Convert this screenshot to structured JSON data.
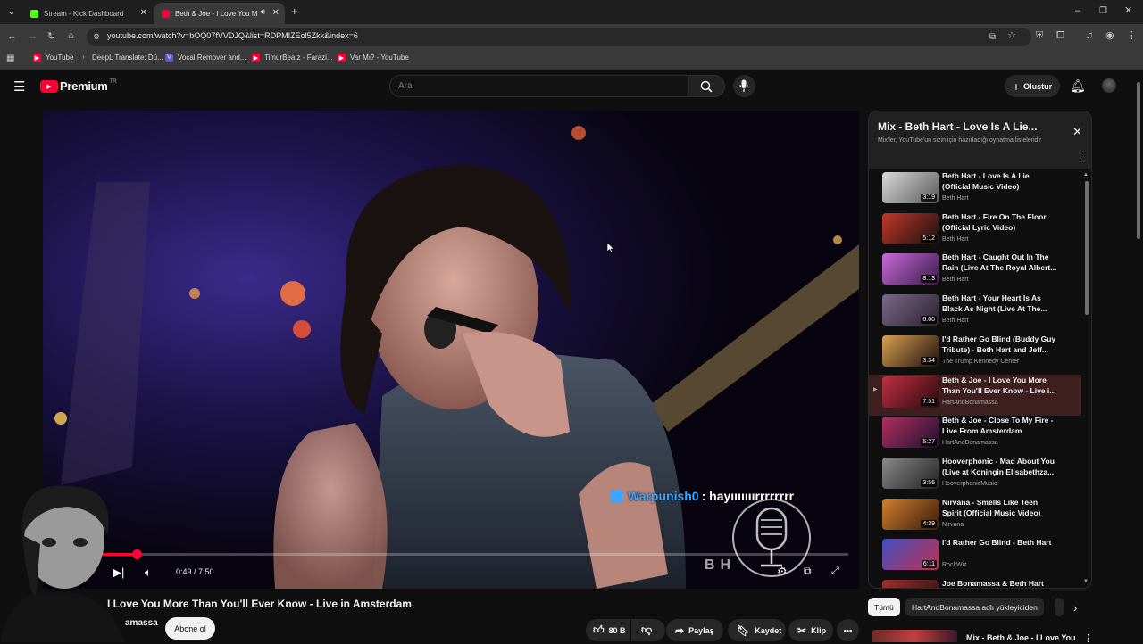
{
  "browser": {
    "tabs": [
      {
        "title": "Stream - Kick Dashboard",
        "active": false,
        "color": "#53fc18"
      },
      {
        "title": "Beth & Joe - I Love You Mo",
        "active": true,
        "color": "#ff0033"
      }
    ],
    "url": "youtube.com/watch?v=bOQ07fVVDJQ&list=RDPMIZEol5Zkk&index=6",
    "bookmarks": [
      {
        "label": "YouTube",
        "icon": "youtube-icon"
      },
      {
        "label": "DeepL Translate: Dü...",
        "icon": "deepl-icon"
      },
      {
        "label": "Vocal Remover and...",
        "icon": "v-icon"
      },
      {
        "label": "TimurBeatz - Farazi...",
        "icon": "youtube-icon"
      },
      {
        "label": "Var Mı? - YouTube",
        "icon": "youtube-icon"
      }
    ]
  },
  "youtube": {
    "logo": "Premium",
    "logo_region": "TR",
    "search_placeholder": "Ara",
    "create_label": "Oluştur"
  },
  "player": {
    "time": "0:49 / 7:50",
    "progress": 0.104,
    "chat_user": "Warpunish0",
    "chat_message": ": hayııııııırrrrrrrr",
    "watermark": "BH"
  },
  "video_info": {
    "title": "I Love You More Than You'll Ever Know - Live in Amsterdam",
    "channel": "amassa",
    "subscribe": "Abone ol",
    "likes": "80 B",
    "share": "Paylaş",
    "save": "Kaydet",
    "clip": "Klip"
  },
  "playlist": {
    "title": "Mix - Beth Hart - Love Is A Lie...",
    "subtitle": "Mix'ler, YouTube'un sizin için hazırladığı oynatma listeleridir",
    "items": [
      {
        "title": "Beth Hart - Love Is A Lie (Official Music Video)",
        "channel": "Beth Hart",
        "duration": "3:19"
      },
      {
        "title": "Beth Hart - Fire On The Floor (Official Lyric Video)",
        "channel": "Beth Hart",
        "duration": "5:12"
      },
      {
        "title": "Beth Hart - Caught Out In The Rain (Live At The Royal Albert...",
        "channel": "Beth Hart",
        "duration": "8:13"
      },
      {
        "title": "Beth Hart - Your Heart Is As Black As Night (Live At The...",
        "channel": "Beth Hart",
        "duration": "6:00"
      },
      {
        "title": "I'd Rather Go Blind (Buddy Guy Tribute) - Beth Hart and Jeff...",
        "channel": "The Trump Kennedy Center",
        "duration": "3:34"
      },
      {
        "title": "Beth & Joe - I Love You More Than You'll Ever Know - Live i...",
        "channel": "HartAndBonamassa",
        "duration": "7:51"
      },
      {
        "title": "Beth & Joe - Close To My Fire - Live From Amsterdam",
        "channel": "HartAndBonamassa",
        "duration": "5:27"
      },
      {
        "title": "Hooverphonic - Mad About You (Live at Koningin Elisabethza...",
        "channel": "HooverphonicMusic",
        "duration": "3:56"
      },
      {
        "title": "Nirvana - Smells Like Teen Spirit (Official Music Video)",
        "channel": "Nirvana",
        "duration": "4:39"
      },
      {
        "title": "I'd Rather Go Blind - Beth Hart",
        "channel": "RockWiz",
        "duration": "6:11"
      },
      {
        "title": "Joe Bonamassa & Beth Hart",
        "channel": "",
        "duration": ""
      }
    ],
    "active_index": 5
  },
  "chips": {
    "all": "Tümü",
    "uploads": "HartAndBonamassa adlı yükleyiciden"
  },
  "next_item": {
    "title": "Mix - Beth & Joe - I Love You"
  },
  "colors": {
    "accent_red": "#ff0033",
    "active_row": "#3d1f20"
  }
}
